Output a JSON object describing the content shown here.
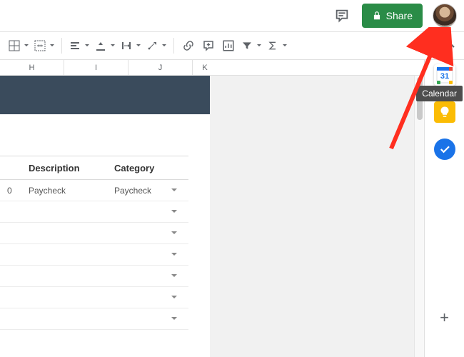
{
  "topbar": {
    "share_label": "Share"
  },
  "toolbar_icons": [
    "borders",
    "merge",
    "halign",
    "valign",
    "wrap",
    "rotate",
    "link",
    "comment-insert",
    "chart",
    "filter",
    "functions"
  ],
  "columns": {
    "h": "H",
    "i": "I",
    "j": "J",
    "k": "K"
  },
  "table": {
    "headers": {
      "left": "",
      "description": "Description",
      "category": "Category"
    },
    "rows": [
      {
        "left": "0",
        "description": "Paycheck",
        "category": "Paycheck"
      },
      {
        "left": "",
        "description": "",
        "category": ""
      },
      {
        "left": "",
        "description": "",
        "category": ""
      },
      {
        "left": "",
        "description": "",
        "category": ""
      },
      {
        "left": "",
        "description": "",
        "category": ""
      },
      {
        "left": "",
        "description": "",
        "category": ""
      },
      {
        "left": "",
        "description": "",
        "category": ""
      }
    ]
  },
  "sidepanel": {
    "calendar_day": "31",
    "tooltip": "Calendar"
  }
}
